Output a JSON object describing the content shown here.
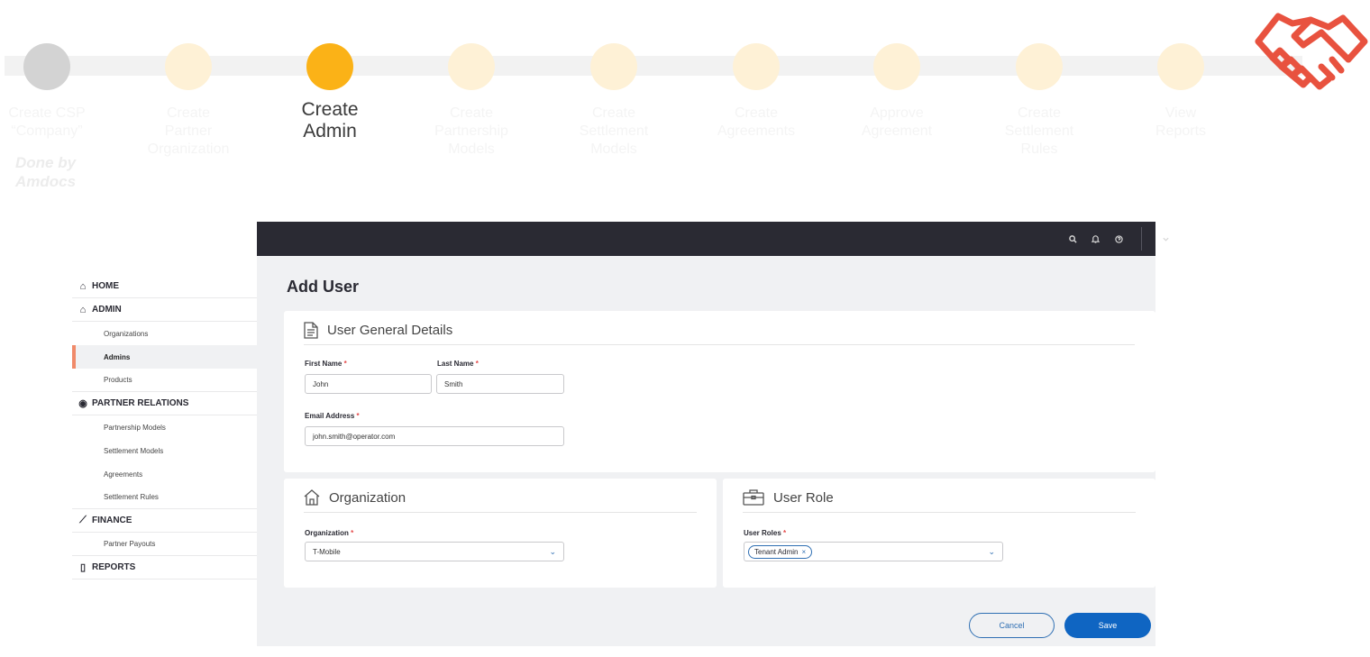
{
  "stepper": {
    "steps": [
      {
        "label": "Create CSP\n“Company”",
        "state": "done"
      },
      {
        "label": "Create\nPartner\nOrganization",
        "state": "pending"
      },
      {
        "label": "Create\nAdmin",
        "state": "current"
      },
      {
        "label": "Create\nPartnership\nModels",
        "state": "pending"
      },
      {
        "label": "Create\nSettlement\nModels",
        "state": "pending"
      },
      {
        "label": "Create\nAgreements",
        "state": "pending"
      },
      {
        "label": "Approve\nAgreement",
        "state": "pending"
      },
      {
        "label": "Create\nSettlement\nRules",
        "state": "pending"
      },
      {
        "label": "View\nReports",
        "state": "pending"
      }
    ],
    "done_note": "Done by\nAmdocs",
    "logo_icon": "handshake-icon",
    "colors": {
      "current": "#fbb217",
      "done": "#d3d3d3",
      "pending": "#fef1d6",
      "logo": "#e8523f"
    }
  },
  "topbar": {
    "icons": [
      "search-icon",
      "bell-icon",
      "help-icon",
      "chevron-down-icon"
    ]
  },
  "sidebar": {
    "sections": [
      {
        "label": "HOME",
        "icon": "home-icon",
        "items": []
      },
      {
        "label": "ADMIN",
        "icon": "admin-icon",
        "items": [
          {
            "label": "Organizations",
            "active": false
          },
          {
            "label": "Admins",
            "active": true
          },
          {
            "label": "Products",
            "active": false
          }
        ]
      },
      {
        "label": "PARTNER RELATIONS",
        "icon": "partner-icon",
        "items": [
          {
            "label": "Partnership Models",
            "active": false
          },
          {
            "label": "Settlement Models",
            "active": false
          },
          {
            "label": "Agreements",
            "active": false
          },
          {
            "label": "Settlement Rules",
            "active": false
          }
        ]
      },
      {
        "label": "FINANCE",
        "icon": "chart-icon",
        "items": [
          {
            "label": "Partner Payouts",
            "active": false
          }
        ]
      },
      {
        "label": "REPORTS",
        "icon": "report-icon",
        "items": []
      }
    ]
  },
  "main": {
    "title": "Add User",
    "general": {
      "heading": "User General Details",
      "first_name_label": "First Name",
      "first_name_value": "John",
      "last_name_label": "Last Name",
      "last_name_value": "Smith",
      "email_label": "Email Address",
      "email_value": "john.smith@operator.com",
      "required_mark": "*"
    },
    "organization": {
      "heading": "Organization",
      "field_label": "Organization",
      "selected": "T-Mobile"
    },
    "role": {
      "heading": "User Role",
      "field_label": "User Roles",
      "chips": [
        "Tenant Admin"
      ],
      "chip_remove": "×"
    },
    "actions": {
      "cancel_label": "Cancel",
      "save_label": "Save"
    }
  }
}
